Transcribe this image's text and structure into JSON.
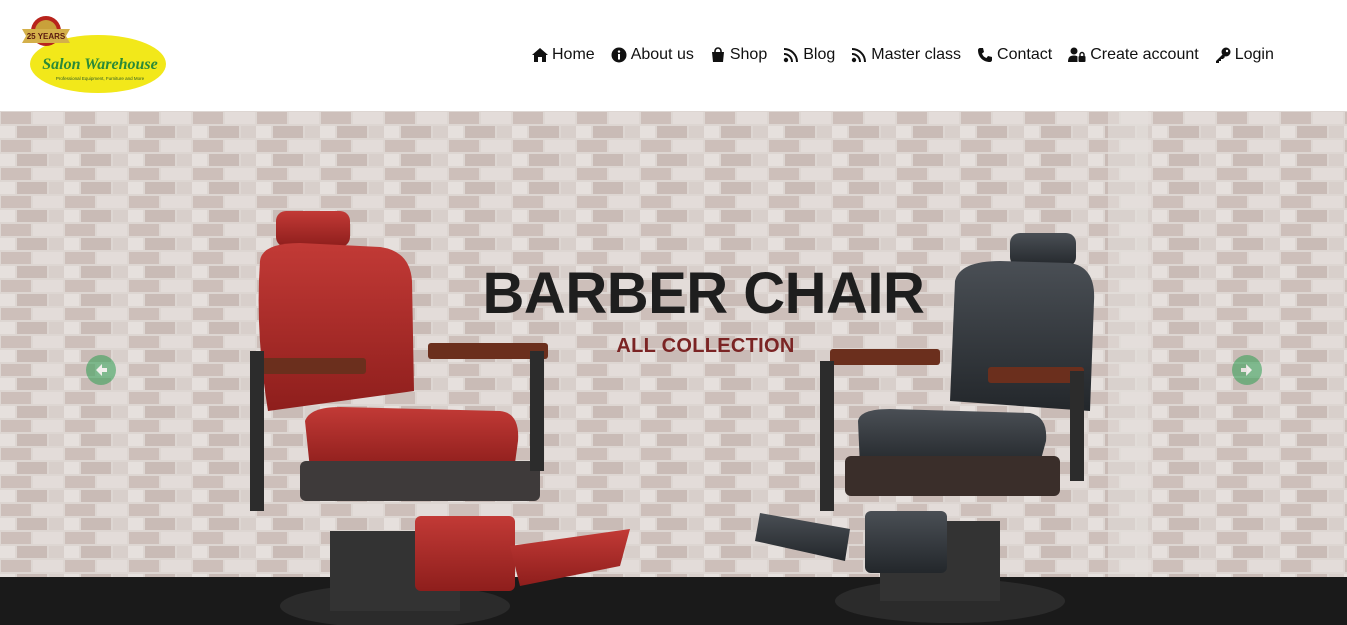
{
  "header": {
    "logo": {
      "badge_text": "25 YEARS",
      "brand_text": "Salon Warehouse",
      "tagline": "Professional Equipment, Furniture and More"
    },
    "nav": [
      {
        "label": "Home",
        "icon": "home-icon"
      },
      {
        "label": "About us",
        "icon": "info-icon"
      },
      {
        "label": "Shop",
        "icon": "shopping-bag-icon"
      },
      {
        "label": "Blog",
        "icon": "rss-icon"
      },
      {
        "label": "Master class",
        "icon": "rss-icon"
      },
      {
        "label": "Contact",
        "icon": "phone-icon"
      },
      {
        "label": "Create account",
        "icon": "user-lock-icon"
      },
      {
        "label": "Login",
        "icon": "key-icon"
      }
    ]
  },
  "hero": {
    "title": "BARBER CHAIR",
    "subtitle": "ALL COLLECTION",
    "prev_icon": "arrow-left-circle-icon",
    "next_icon": "arrow-right-circle-icon",
    "colors": {
      "title": "#1e1e1e",
      "subtitle": "#7b2424",
      "arrows": "#2e9e52"
    }
  }
}
